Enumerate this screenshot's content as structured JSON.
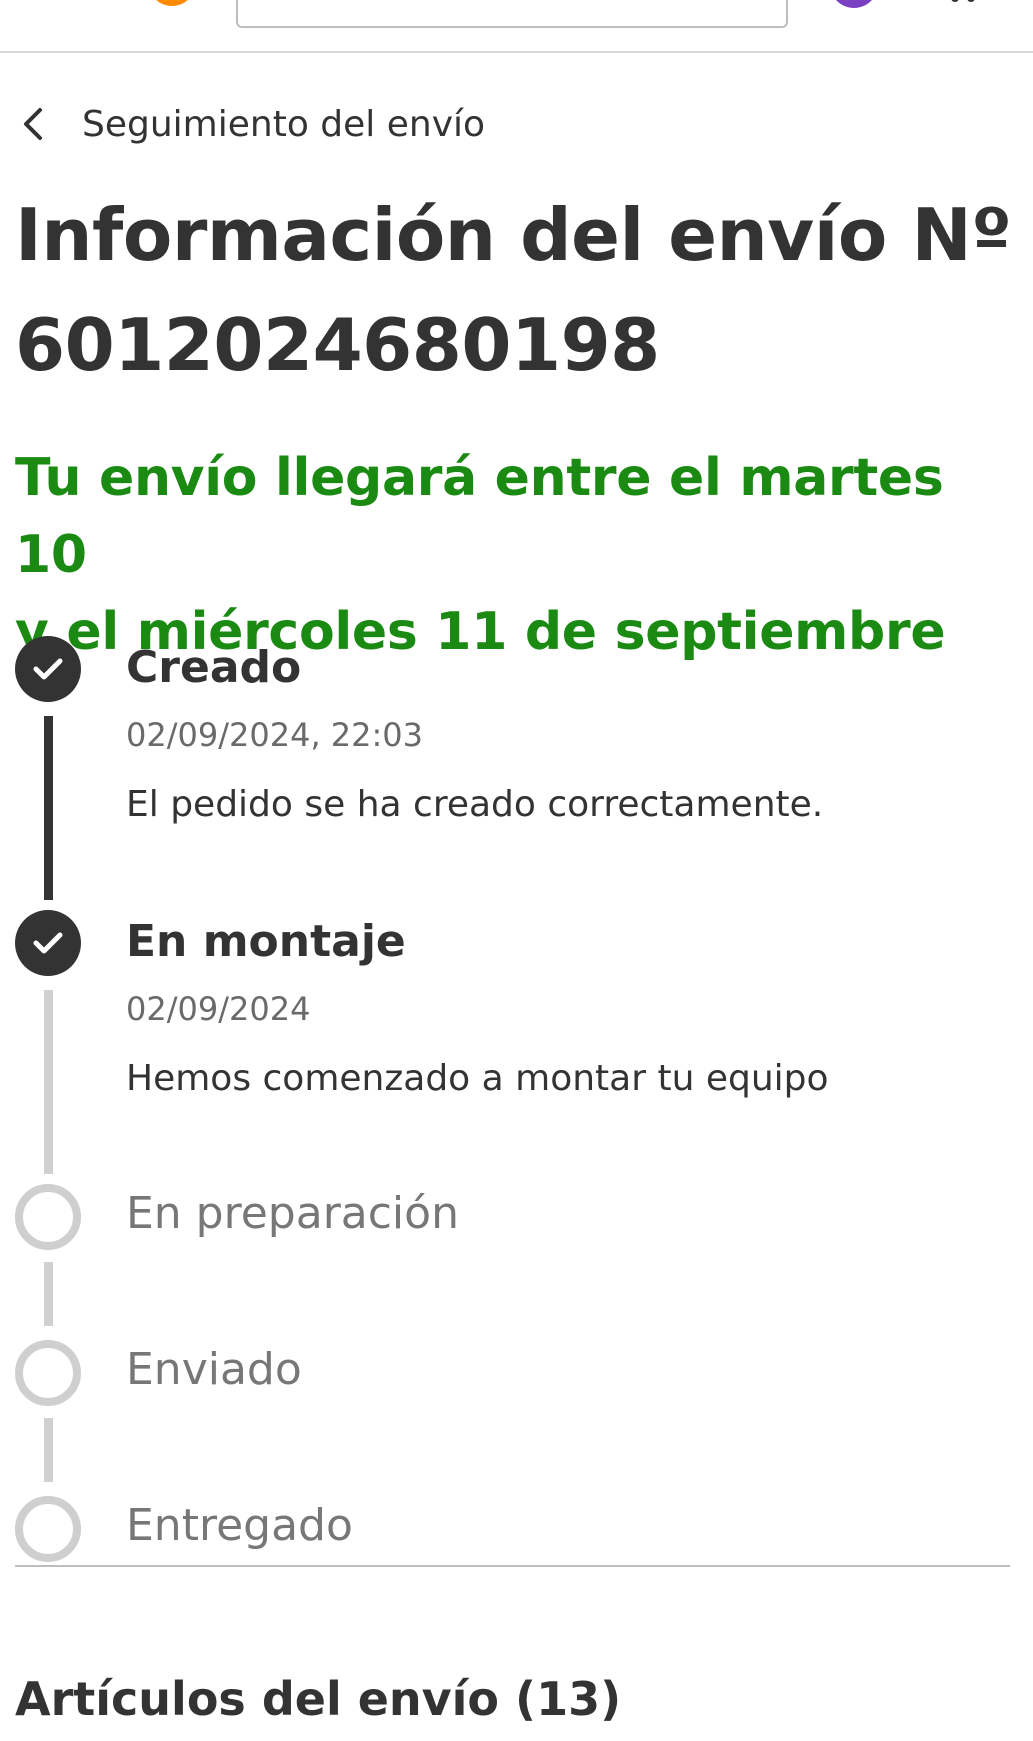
{
  "header": {
    "logo_icon": "logo-icon",
    "search_placeholder": "",
    "avatar_icon": "avatar-icon",
    "cart_icon": "cart-icon",
    "brand_color": "#ff8a00",
    "avatar_color": "#7b3fc4"
  },
  "breadcrumb": {
    "back_icon": "chevron-left-icon",
    "label": "Seguimiento del envío"
  },
  "page": {
    "title_line1": "Información del envío Nº",
    "title_line2": "6012024680198",
    "eta_line1": "Tu envío llegará entre el martes 10",
    "eta_line2": "y el miércoles 11 de septiembre",
    "eta_color": "#1a8a12"
  },
  "timeline": {
    "steps": [
      {
        "title": "Creado",
        "date": "02/09/2024, 22:03",
        "description": "El pedido se ha creado correctamente.",
        "status": "done",
        "icon": "check-icon"
      },
      {
        "title": "En montaje",
        "date": "02/09/2024",
        "description": "Hemos comenzado a montar tu equipo",
        "status": "done",
        "icon": "check-icon"
      },
      {
        "title": "En preparación",
        "status": "pending"
      },
      {
        "title": "Enviado",
        "status": "pending"
      },
      {
        "title": "Entregado",
        "status": "pending"
      }
    ]
  },
  "articles": {
    "title": "Artículos del envío (13)"
  }
}
